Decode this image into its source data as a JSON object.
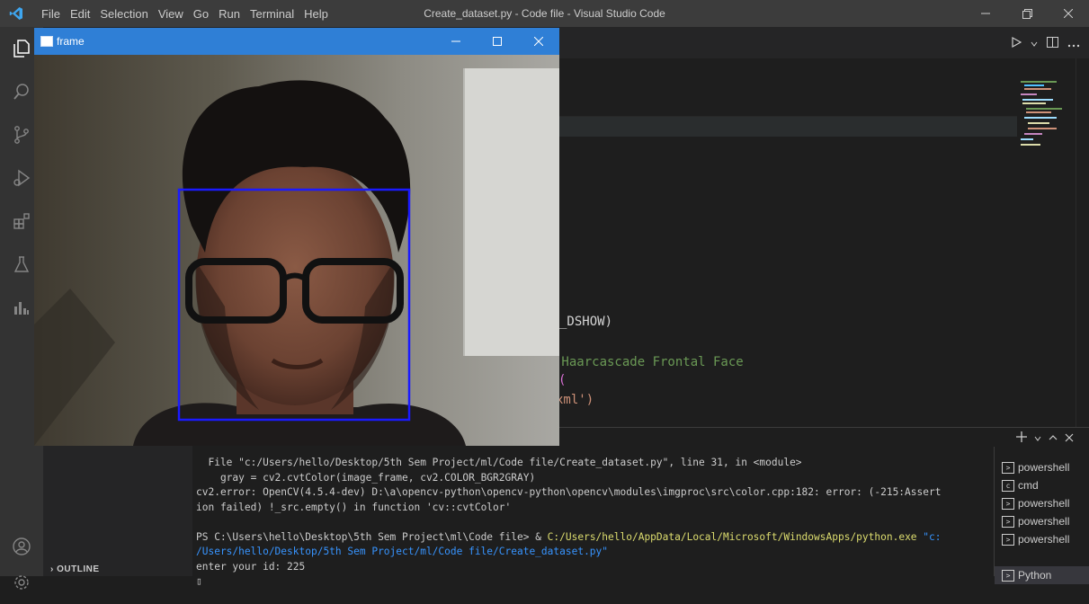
{
  "titlebar": {
    "menu": [
      "File",
      "Edit",
      "Selection",
      "View",
      "Go",
      "Run",
      "Terminal",
      "Help"
    ],
    "title": "Create_dataset.py - Code file - Visual Studio Code"
  },
  "sidebar": {
    "outline_label": "OUTLINE"
  },
  "editor": {
    "visible_code": [
      {
        "text": "_DSHOW)",
        "color": "#d4d4d4"
      },
      {
        "text": " Haarcascade Frontal Face",
        "color": "#6a9955"
      },
      {
        "text": "(",
        "color": "#ffd700"
      },
      {
        "text": "xml",
        "color": "#ce9178"
      },
      {
        "text": "')",
        "color": "#d4d4d4"
      }
    ]
  },
  "frame_window": {
    "title": "frame"
  },
  "terminal": {
    "lines": [
      "  File \"c:/Users/hello/Desktop/5th Sem Project/ml/Code file/Create_dataset.py\", line 31, in <module>",
      "    gray = cv2.cvtColor(image_frame, cv2.COLOR_BGR2GRAY)",
      "cv2.error: OpenCV(4.5.4-dev) D:\\a\\opencv-python\\opencv-python\\opencv\\modules\\imgproc\\src\\color.cpp:182: error: (-215:Assert",
      "ion failed) !_src.empty() in function 'cv::cvtColor'",
      ""
    ],
    "prompt": "PS C:\\Users\\hello\\Desktop\\5th Sem Project\\ml\\Code file> ",
    "command_amp": "& ",
    "command_exe": "C:/Users/hello/AppData/Local/Microsoft/WindowsApps/python.exe",
    "command_arg1": " \"c:",
    "command_arg2": "/Users/hello/Desktop/5th Sem Project/ml/Code file/Create_dataset.py\"",
    "input_line": "enter your id: 225",
    "cursor": "▯"
  },
  "terminal_list": [
    "powershell",
    "cmd",
    "powershell",
    "powershell",
    "powershell",
    "Python"
  ],
  "colors": {
    "accent": "#007acc",
    "frame_titlebar": "#2f7fd6",
    "face_box": "#1a1aff",
    "string_yellow": "#dcdc6e",
    "string_orange": "#ce9178"
  }
}
